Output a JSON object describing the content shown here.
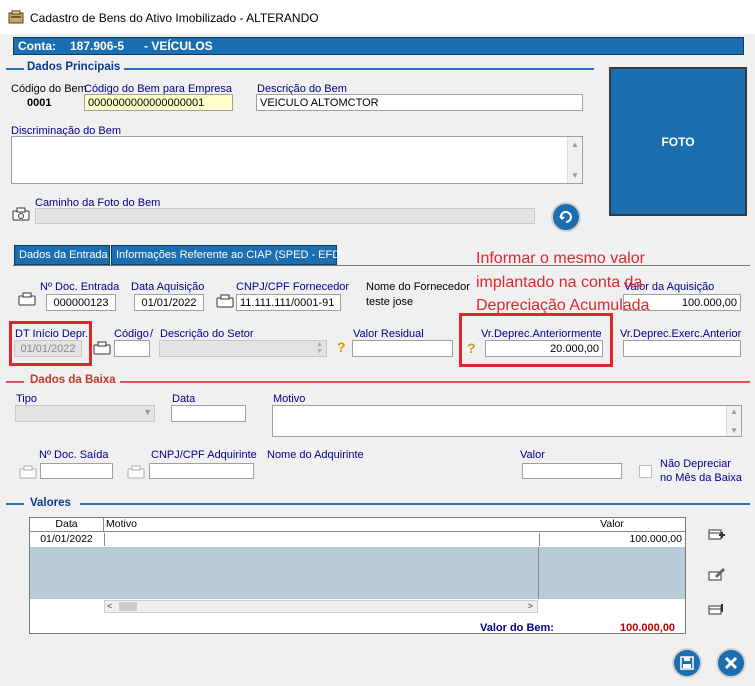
{
  "window": {
    "title": "Cadastro de Bens do Ativo Imobilizado   -   ALTERANDO"
  },
  "conta": {
    "label": "Conta:",
    "number": "187.906-5",
    "name": "- VEÍCULOS"
  },
  "dados_principais": {
    "heading": "Dados Principais",
    "codigo_bem_label": "Código do Bem",
    "codigo_bem_value": "0001",
    "codigo_empresa_label": "Código do Bem para Empresa",
    "codigo_empresa_value": "0000000000000000001",
    "descricao_label": "Descrição do Bem",
    "descricao_value": "VEICULO ALTOMCTOR",
    "discriminacao_label": "Discriminação do Bem",
    "caminho_foto_label": "Caminho da Foto do Bem",
    "foto_label": "FOTO"
  },
  "tabs": [
    {
      "label": "Dados da Entrada"
    },
    {
      "label": "Informações Referente ao CIAP (SPED - EFD)"
    }
  ],
  "entrada": {
    "doc_entrada_label": "Nº Doc. Entrada",
    "doc_entrada_value": "000000123",
    "data_aquisicao_label": "Data Aquisição",
    "data_aquisicao_value": "01/01/2022",
    "cnpj_label": "CNPJ/CPF Fornecedor",
    "cnpj_value": "11.111.111/0001-91",
    "fornecedor_label": "Nome do Fornecedor",
    "fornecedor_value": "teste jose",
    "valor_aquisicao_label": "Valor da Aquisição",
    "valor_aquisicao_value": "100.000,00",
    "dt_inicio_label": "DT Início Depr.",
    "dt_inicio_value": "01/01/2022",
    "codigo_label": "Código",
    "slash": "/",
    "desc_setor_label": "Descrição do Setor",
    "valor_residual_label": "Valor Residual",
    "vr_deprec_ant_label": "Vr.Deprec.Anteriormente",
    "vr_deprec_ant_value": "20.000,00",
    "vr_deprec_exerc_label": "Vr.Deprec.Exerc.Anterior"
  },
  "annotation": {
    "line1": "Informar o mesmo valor",
    "line2": "implantado na conta da",
    "line3": "Depreciação Acumulada"
  },
  "baixa": {
    "heading": "Dados da Baixa",
    "tipo_label": "Tipo",
    "data_label": "Data",
    "motivo_label": "Motivo",
    "doc_saida_label": "Nº Doc. Saída",
    "cnpj_adq_label": "CNPJ/CPF Adquirinte",
    "nome_adq_label": "Nome do Adquirinte",
    "valor_label": "Valor",
    "nao_depreciar_line1": "Não Depreciar",
    "nao_depreciar_line2": "no Mês da Baixa"
  },
  "valores": {
    "heading": "Valores",
    "columns": [
      "Data",
      "Motivo",
      "Valor"
    ],
    "rows": [
      {
        "data": "01/01/2022",
        "motivo": "",
        "valor": "100.000,00"
      }
    ],
    "total_label": "Valor do Bem:",
    "total_value": "100.000,00"
  },
  "colors": {
    "accent": "#1b6fb0",
    "annotation": "#e0262b",
    "total": "#c00000"
  },
  "icons": [
    "app-icon",
    "camera-icon",
    "refresh-icon",
    "question-icon",
    "add-row-icon",
    "edit-row-icon",
    "delete-row-icon",
    "save-icon",
    "close-icon"
  ]
}
